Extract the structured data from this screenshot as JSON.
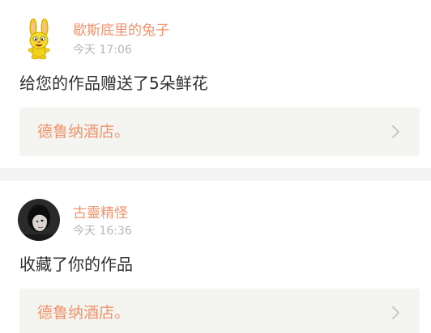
{
  "notifications": [
    {
      "username": "歇斯底里的兔子",
      "time": "今天 17:06",
      "message": "给您的作品赠送了5朵鲜花",
      "work_title": "德鲁纳酒店。",
      "avatar_icon": "yellow-rabbit-avatar-icon"
    },
    {
      "username": "古靈精怪",
      "time": "今天 16:36",
      "message": "收藏了你的作品",
      "work_title": "德鲁纳酒店。",
      "avatar_icon": "person-photo-avatar-icon"
    }
  ],
  "colors": {
    "accent": "#f0926a",
    "timestamp": "#b6b6b6",
    "body_text": "#2f2f2f",
    "link_bg": "#f4f4f1",
    "separator": "#f3f3f3"
  }
}
